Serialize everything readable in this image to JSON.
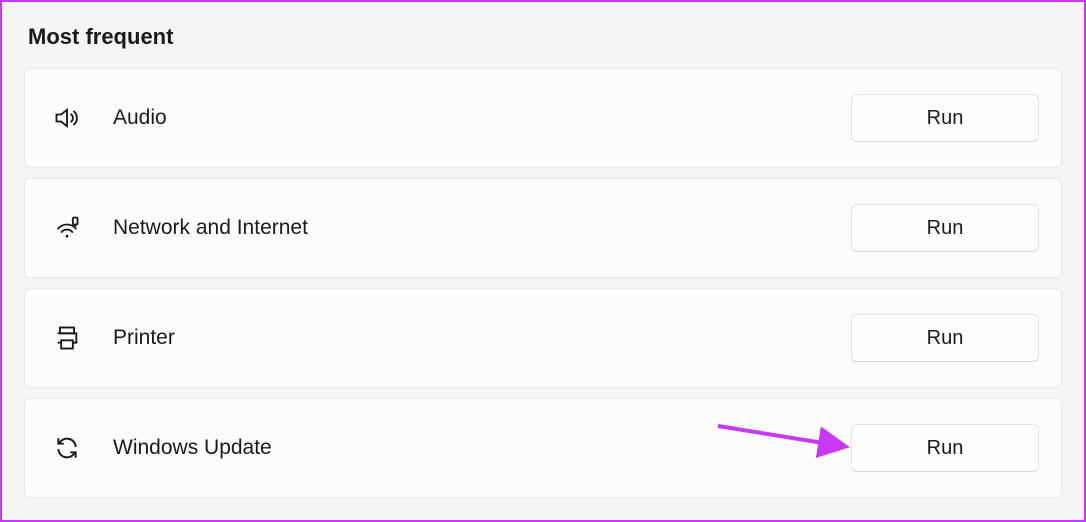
{
  "section_title": "Most frequent",
  "run_label": "Run",
  "items": [
    {
      "icon": "audio-icon",
      "label": "Audio"
    },
    {
      "icon": "network-icon",
      "label": "Network and Internet"
    },
    {
      "icon": "printer-icon",
      "label": "Printer"
    },
    {
      "icon": "update-icon",
      "label": "Windows Update"
    }
  ],
  "annotation_color": "#c838f6"
}
